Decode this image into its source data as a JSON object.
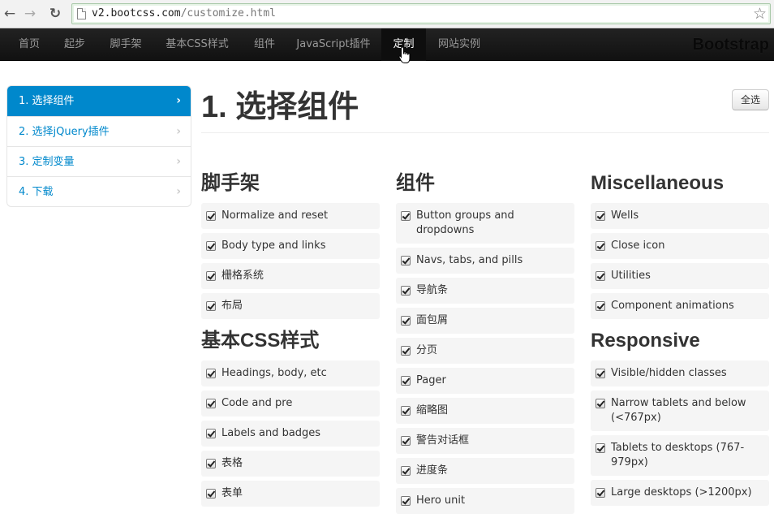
{
  "browser": {
    "back_icon": "arrow-left-icon",
    "forward_icon": "arrow-right-icon",
    "reload_icon": "reload-icon",
    "url_host": "v2.bootcss.com",
    "url_path": "/customize.html",
    "bookmark_icon": "star-icon"
  },
  "navbar": {
    "items": [
      "首页",
      "起步",
      "脚手架",
      "基本CSS样式",
      "组件",
      "JavaScript插件",
      "定制",
      "网站实例"
    ],
    "active_index": 6,
    "brand": "Bootstrap"
  },
  "sidebar": {
    "items": [
      {
        "label": "1. 选择组件",
        "active": true
      },
      {
        "label": "2. 选择jQuery插件",
        "active": false
      },
      {
        "label": "3. 定制变量",
        "active": false
      },
      {
        "label": "4. 下载",
        "active": false
      }
    ],
    "chevron": "›"
  },
  "main": {
    "title": "1. 选择组件",
    "select_all": "全选",
    "columns": [
      {
        "groups": [
          {
            "heading": "脚手架",
            "options": [
              "Normalize and reset",
              "Body type and links",
              "栅格系统",
              "布局"
            ]
          },
          {
            "heading": "基本CSS样式",
            "options": [
              "Headings, body, etc",
              "Code and pre",
              "Labels and badges",
              "表格",
              "表单"
            ]
          }
        ]
      },
      {
        "groups": [
          {
            "heading": "组件",
            "options": [
              "Button groups and dropdowns",
              "Navs, tabs, and pills",
              "导航条",
              "面包屑",
              "分页",
              "Pager",
              "缩略图",
              "警告对话框",
              "进度条",
              "Hero unit"
            ]
          }
        ]
      },
      {
        "groups": [
          {
            "heading": "Miscellaneous",
            "options": [
              "Wells",
              "Close icon",
              "Utilities",
              "Component animations"
            ]
          },
          {
            "heading": "Responsive",
            "options": [
              "Visible/hidden classes",
              "Narrow tablets and below (<767px)",
              "Tablets to desktops (767-979px)",
              "Large desktops (>1200px)"
            ]
          }
        ]
      }
    ]
  },
  "colors": {
    "accent": "#0088cc",
    "navbar_bg": "#1b1b1b",
    "option_bg": "#f5f5f5"
  }
}
